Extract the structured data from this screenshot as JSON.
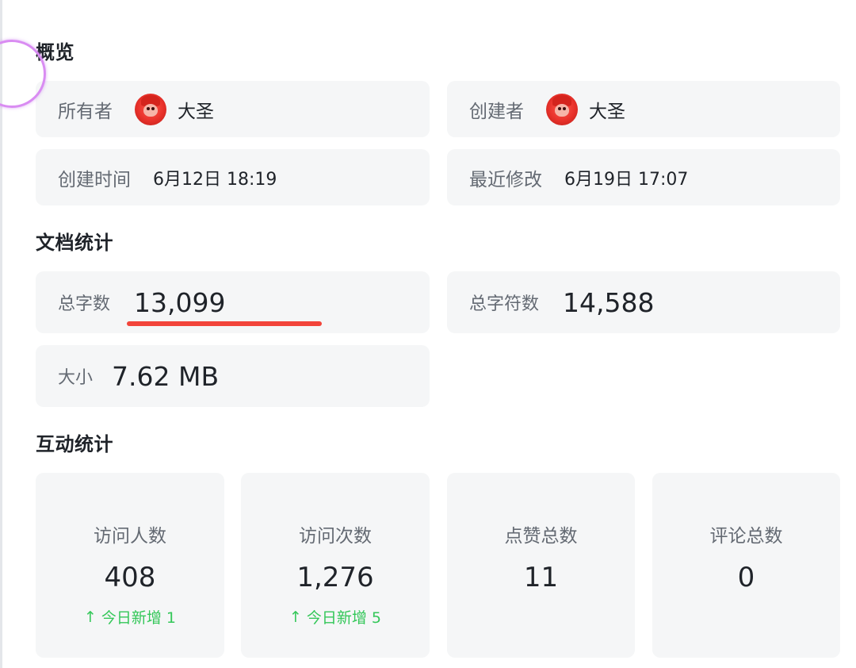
{
  "overview": {
    "title": "概览",
    "owner": {
      "label": "所有者",
      "name": "大圣"
    },
    "creator": {
      "label": "创建者",
      "name": "大圣"
    },
    "created_time": {
      "label": "创建时间",
      "value": "6月12日 18:19"
    },
    "modified_time": {
      "label": "最近修改",
      "value": "6月19日 17:07"
    }
  },
  "doc_stats": {
    "title": "文档统计",
    "word_count": {
      "label": "总字数",
      "value": "13,099"
    },
    "char_count": {
      "label": "总字符数",
      "value": "14,588"
    },
    "size": {
      "label": "大小",
      "value": "7.62 MB"
    }
  },
  "interaction_stats": {
    "title": "互动统计",
    "items": [
      {
        "label": "访问人数",
        "value": "408",
        "delta": "今日新增 1"
      },
      {
        "label": "访问次数",
        "value": "1,276",
        "delta": "今日新增 5"
      },
      {
        "label": "点赞总数",
        "value": "11",
        "delta": ""
      },
      {
        "label": "评论总数",
        "value": "0",
        "delta": ""
      }
    ]
  },
  "colors": {
    "card_bg": "#f5f6f7",
    "highlight_underline": "#f2443a",
    "delta_green": "#34c759",
    "cursor_ring": "#d98cf2"
  },
  "icons": {
    "avatar": "red-monkey-avatar-icon",
    "delta_arrow": "arrow-up-icon"
  }
}
